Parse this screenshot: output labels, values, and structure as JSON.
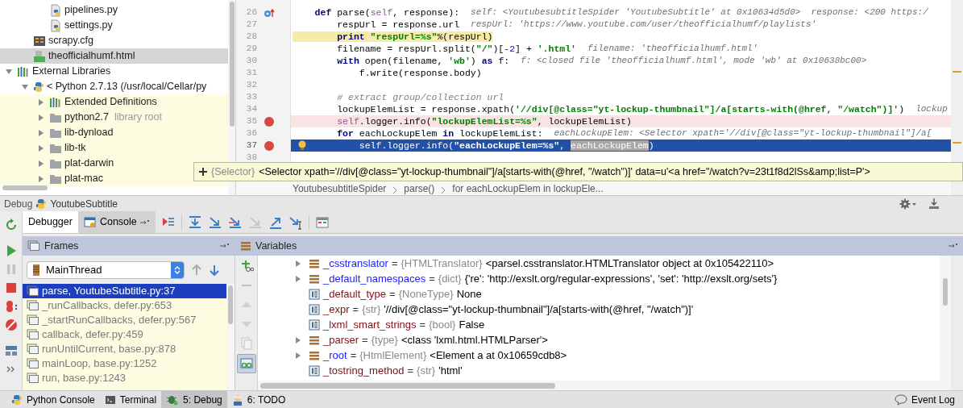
{
  "project_tree": [
    {
      "children": [
        {
          "children": [
            {
              "label": "pipelines.py",
              "kind": "python-file",
              "selected": false
            },
            {
              "label": "settings.py",
              "kind": "python-file",
              "selected": false
            }
          ]
        },
        {
          "label": "scrapy.cfg",
          "kind": "config-file",
          "selected": false
        },
        {
          "label": "theofficialhumf.html",
          "kind": "html-file",
          "selected": true
        }
      ]
    },
    {
      "label": "External Libraries",
      "kind": "library",
      "selected": false,
      "expanded": true,
      "children": [
        {
          "label": "< Python 2.7.13 (/usr/local/Cellar/py",
          "kind": "python-sdk",
          "selected": false,
          "expanded": true,
          "children": [
            {
              "label": "Extended Definitions",
              "kind": "library",
              "selected": false,
              "expanded": false,
              "highlighted": true
            },
            {
              "label": "python2.7",
              "note": "library root",
              "kind": "folder",
              "selected": false,
              "expanded": false,
              "highlighted": true
            },
            {
              "label": "lib-dynload",
              "kind": "folder",
              "selected": false,
              "expanded": false,
              "highlighted": true
            },
            {
              "label": "lib-tk",
              "kind": "folder",
              "selected": false,
              "expanded": false,
              "highlighted": true
            },
            {
              "label": "plat-darwin",
              "kind": "folder",
              "selected": false,
              "expanded": false,
              "highlighted": true
            },
            {
              "label": "plat-mac",
              "kind": "folder",
              "selected": false,
              "expanded": false,
              "highlighted": true
            }
          ]
        }
      ]
    }
  ],
  "editor": {
    "lines": [
      {
        "number": "26",
        "kind": "method",
        "breakpoint": false,
        "tokens": [
          {
            "kind": "keyword",
            "text": "    def"
          },
          {
            "kind": "plain",
            "text": " parse("
          },
          {
            "kind": "self",
            "text": "self"
          },
          {
            "kind": "plain",
            "text": ", response):"
          }
        ],
        "hint": "self: <YoutubesubtitleSpider 'YoutubeSubtitle' at 0x10634d5d0>  response: <200 https:/"
      },
      {
        "number": "27",
        "kind": "plain",
        "breakpoint": false,
        "tokens": [
          {
            "kind": "plain",
            "text": "        respUrl = response.url"
          }
        ],
        "hint": "respUrl: 'https://www.youtube.com/user/theofficialhumf/playlists'"
      },
      {
        "number": "28",
        "kind": "plain",
        "breakpoint": false,
        "text_highlight": true,
        "tokens": [
          {
            "kind": "keyword",
            "text": "        print"
          },
          {
            "kind": "string",
            "text": " \"respUrl=%s\""
          },
          {
            "kind": "plain",
            "text": "%(respUrl)"
          }
        ]
      },
      {
        "number": "29",
        "kind": "plain",
        "breakpoint": false,
        "tokens": [
          {
            "kind": "plain",
            "text": "        filename = respUrl.split("
          },
          {
            "kind": "string",
            "text": "\"/\""
          },
          {
            "kind": "plain",
            "text": ")["
          },
          {
            "kind": "number",
            "text": "-2"
          },
          {
            "kind": "plain",
            "text": "] + "
          },
          {
            "kind": "string",
            "text": "'.html'"
          }
        ],
        "hint": "filename: 'theofficialhumf.html'"
      },
      {
        "number": "30",
        "kind": "plain",
        "breakpoint": false,
        "tokens": [
          {
            "kind": "keyword",
            "text": "        with"
          },
          {
            "kind": "plain",
            "text": " open(filename, "
          },
          {
            "kind": "string",
            "text": "'wb'"
          },
          {
            "kind": "plain",
            "text": ") "
          },
          {
            "kind": "keyword",
            "text": "as"
          },
          {
            "kind": "plain",
            "text": " f:"
          }
        ],
        "hint": "f: <closed file 'theofficialhumf.html', mode 'wb' at 0x10638bc00>"
      },
      {
        "number": "31",
        "kind": "plain",
        "breakpoint": false,
        "tokens": [
          {
            "kind": "plain",
            "text": "            f.write(response.body)"
          }
        ]
      },
      {
        "number": "32",
        "kind": "plain",
        "breakpoint": false
      },
      {
        "number": "33",
        "kind": "plain",
        "breakpoint": false,
        "tokens": [
          {
            "kind": "comment",
            "text": "        # extract group/collection url"
          }
        ]
      },
      {
        "number": "34",
        "kind": "plain",
        "breakpoint": false,
        "tokens": [
          {
            "kind": "plain",
            "text": "        lockupElemList = response.xpath("
          },
          {
            "kind": "string",
            "text": "'//div[@class=\"yt-lockup-thumbnail\"]/a[starts-with(@href, \"/watch\")]'"
          },
          {
            "kind": "plain",
            "text": ")"
          }
        ],
        "hint": "lockup"
      },
      {
        "number": "35",
        "kind": "plain",
        "breakpoint": true,
        "current": false,
        "tokens": [
          {
            "kind": "self",
            "text": "        self"
          },
          {
            "kind": "plain",
            "text": ".logger.info("
          },
          {
            "kind": "string",
            "text": "\"lockupElemList=%s\""
          },
          {
            "kind": "plain",
            "text": ", lockupElemList)"
          }
        ]
      },
      {
        "number": "36",
        "kind": "plain",
        "breakpoint": false,
        "tokens": [
          {
            "kind": "keyword",
            "text": "        for"
          },
          {
            "kind": "plain",
            "text": " eachLockupElem "
          },
          {
            "kind": "keyword",
            "text": "in"
          },
          {
            "kind": "plain",
            "text": " lockupElemList:"
          }
        ],
        "hint": "eachLockupElem: <Selector xpath='//div[@class=\"yt-lockup-thumbnail\"]/a["
      },
      {
        "number": "37",
        "kind": "bulb",
        "breakpoint": true,
        "current": true,
        "tokens": [
          {
            "kind": "plain",
            "text": "            self.logger.info("
          },
          {
            "kind": "string",
            "text": "\"eachLockupElem=%s\""
          },
          {
            "kind": "plain",
            "text": ", "
          },
          {
            "kind": "selected",
            "text": "eachLockupElem"
          },
          {
            "kind": "plain",
            "text": ")"
          }
        ]
      },
      {
        "number": "38",
        "kind": "plain",
        "breakpoint": false
      }
    ],
    "breadcrumbs": [
      "YoutubesubtitleSpider",
      "parse()",
      "for eachLockupElem in lockupEle..."
    ],
    "tooltip": {
      "type": "{Selector}",
      "value": "<Selector xpath='//div[@class=\"yt-lockup-thumbnail\"]/a[starts-with(@href, \"/watch\")]' data=u'<a href=\"/watch?v=23t1f8d2lSs&amp;list=P'>"
    }
  },
  "debug": {
    "label": "Debug",
    "config": "YoutubeSubtitle",
    "tabs": [
      {
        "label": "Debugger",
        "selected": true
      },
      {
        "label": "Console",
        "selected": false
      }
    ],
    "frames": {
      "title": "Frames",
      "thread": "MainThread",
      "items": [
        {
          "label": "parse, YoutubeSubtitle.py:37",
          "selected": true
        },
        {
          "label": "_runCallbacks, defer.py:653",
          "selected": false
        },
        {
          "label": "_startRunCallbacks, defer.py:567",
          "selected": false
        },
        {
          "label": "callback, defer.py:459",
          "selected": false
        },
        {
          "label": "runUntilCurrent, base.py:878",
          "selected": false
        },
        {
          "label": "mainLoop, base.py:1252",
          "selected": false
        },
        {
          "label": "run, base.py:1243",
          "selected": false
        }
      ]
    },
    "variables": {
      "title": "Variables",
      "items": [
        {
          "kind": "object",
          "name": "_csstranslator",
          "color": "#1a1aff",
          "equals": "=",
          "type": "{HTMLTranslator}",
          "value": "<parsel.csstranslator.HTMLTranslator object at 0x105422110>"
        },
        {
          "kind": "object",
          "name": "_default_namespaces",
          "color": "#1a1aff",
          "equals": "=",
          "type": "{dict}",
          "value": "{'re': 'http://exslt.org/regular-expressions', 'set': 'http://exslt.org/sets'}"
        },
        {
          "kind": "value",
          "name": "_default_type",
          "color": "#7f0f14",
          "equals": "=",
          "type": "{NoneType}",
          "value": "None"
        },
        {
          "kind": "value",
          "name": "_expr",
          "color": "#7f0f14",
          "equals": "=",
          "type": "{str}",
          "value": "'//div[@class=\"yt-lockup-thumbnail\"]/a[starts-with(@href, \"/watch\")]'"
        },
        {
          "kind": "value",
          "name": "_lxml_smart_strings",
          "color": "#7f0f14",
          "equals": "=",
          "type": "{bool}",
          "value": "False"
        },
        {
          "kind": "object",
          "name": "_parser",
          "color": "#7f0f14",
          "equals": "=",
          "type": "{type}",
          "value": "<class 'lxml.html.HTMLParser'>"
        },
        {
          "kind": "object",
          "name": "_root",
          "color": "#1a1aff",
          "equals": "=",
          "type": "{HtmlElement}",
          "value": "<Element a at 0x10659cdb8>"
        },
        {
          "kind": "value",
          "name": "_tostring_method",
          "color": "#7f0f14",
          "equals": "=",
          "type": "{str}",
          "value": "'html'"
        }
      ]
    }
  },
  "status_bar": {
    "tools": [
      {
        "label": "Python Console",
        "kind": "python",
        "selected": false
      },
      {
        "label": "Terminal",
        "kind": "terminal",
        "selected": false
      },
      {
        "label": "5: Debug",
        "kind": "bug",
        "selected": true
      },
      {
        "label": "6: TODO",
        "kind": "todo",
        "selected": false
      }
    ],
    "event_log": "Event Log"
  }
}
